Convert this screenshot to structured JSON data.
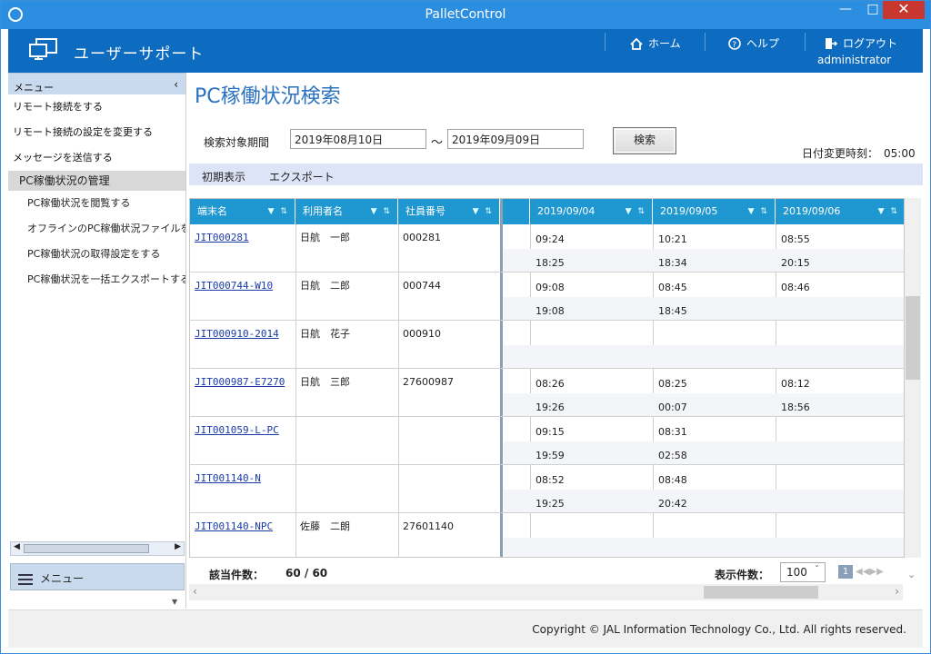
{
  "window": {
    "title": "PalletControl",
    "minimize_icon": "minimize-icon",
    "maximize_icon": "maximize-icon",
    "close_icon": "close-icon"
  },
  "header": {
    "brand": "ユーザーサポート",
    "home": "ホーム",
    "help": "ヘルプ",
    "logout": "ログアウト",
    "user": "administrator"
  },
  "sidebar": {
    "menu_title": "メニュー",
    "items": [
      "リモート接続をする",
      "リモート接続の設定を変更する",
      "メッセージを送信する"
    ],
    "group": "PC稼働状況の管理",
    "subitems": [
      "PC稼働状況を閲覧する",
      "オフラインのPC稼働状況ファイルを取り",
      "PC稼働状況の取得設定をする",
      "PC稼働状況を一括エクスポートする"
    ],
    "footer_menu": "メニュー"
  },
  "main": {
    "title": "PC稼働状況検索",
    "period_label": "検索対象期間",
    "from_date": "2019年08月10日",
    "tilde": "～",
    "to_date": "2019年09月09日",
    "search_button": "検索",
    "date_change_label": "日付変更時刻：　05:00",
    "toolbar_initial": "初期表示",
    "toolbar_export": "エクスポート",
    "columns": [
      "端末名",
      "利用者名",
      "社員番号",
      "2019/09/04",
      "2019/09/05",
      "2019/09/06"
    ],
    "rows": [
      {
        "terminal": "JIT000281",
        "user": "日航　一郎",
        "emp": "000281",
        "d04": [
          "09:24",
          "18:25"
        ],
        "d05": [
          "10:21",
          "18:34"
        ],
        "d06": [
          "08:55",
          "20:15"
        ]
      },
      {
        "terminal": "JIT000744-W10",
        "user": "日航　二郎",
        "emp": "000744",
        "d04": [
          "09:08",
          "19:08"
        ],
        "d05": [
          "08:45",
          "18:45"
        ],
        "d06": [
          "08:46",
          ""
        ]
      },
      {
        "terminal": "JIT000910-2014",
        "user": "日航　花子",
        "emp": "000910",
        "d04": [
          "",
          ""
        ],
        "d05": [
          "",
          ""
        ],
        "d06": [
          "",
          ""
        ]
      },
      {
        "terminal": "JIT000987-E7270",
        "user": "日航　三郎",
        "emp": "27600987",
        "d04": [
          "08:26",
          "19:26"
        ],
        "d05": [
          "08:25",
          "00:07"
        ],
        "d06": [
          "08:12",
          "18:56"
        ]
      },
      {
        "terminal": "JIT001059-L-PC",
        "user": "",
        "emp": "",
        "d04": [
          "09:15",
          "19:59"
        ],
        "d05": [
          "08:31",
          "02:58"
        ],
        "d06": [
          "",
          ""
        ]
      },
      {
        "terminal": "JIT001140-N",
        "user": "",
        "emp": "",
        "d04": [
          "08:52",
          "19:25"
        ],
        "d05": [
          "08:48",
          "20:42"
        ],
        "d06": [
          "",
          ""
        ]
      },
      {
        "terminal": "JIT001140-NPC",
        "user": "佐藤　二朗",
        "emp": "27601140",
        "d04": [
          "",
          ""
        ],
        "d05": [
          "",
          ""
        ],
        "d06": [
          "",
          ""
        ]
      }
    ],
    "summary_label": "該当件数：",
    "summary_value": "60 / 60",
    "page_size_label": "表示件数：",
    "page_size": "100",
    "page_current": "1"
  },
  "footer": {
    "copyright": "Copyright © JAL Information Technology Co., Ltd. All rights reserved."
  }
}
